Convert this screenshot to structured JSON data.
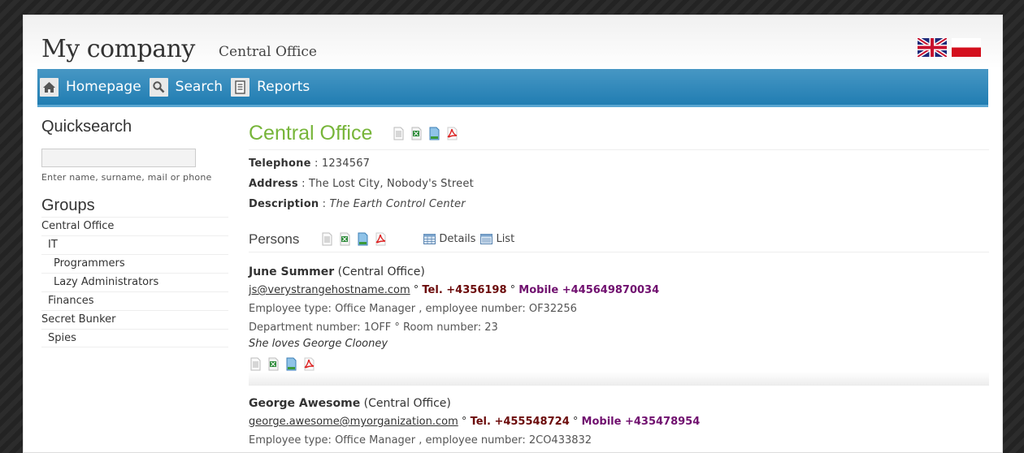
{
  "header": {
    "logo": "My company",
    "subtitle": "Central Office",
    "languages": [
      {
        "name": "English",
        "icon": "flag-uk-icon"
      },
      {
        "name": "Polish",
        "icon": "flag-pl-icon"
      }
    ]
  },
  "nav": {
    "items": [
      {
        "label": "Homepage",
        "icon": "home-icon"
      },
      {
        "label": "Search",
        "icon": "search-icon"
      },
      {
        "label": "Reports",
        "icon": "document-icon"
      }
    ]
  },
  "sidebar": {
    "quicksearch_title": "Quicksearch",
    "quicksearch_value": "",
    "quicksearch_hint": "Enter name, surname, mail or phone",
    "groups_title": "Groups",
    "groups": [
      {
        "label": "Central Office",
        "level": 0
      },
      {
        "label": "IT",
        "level": 1
      },
      {
        "label": "Programmers",
        "level": 2
      },
      {
        "label": "Lazy Administrators",
        "level": 2
      },
      {
        "label": "Finances",
        "level": 1
      },
      {
        "label": "Secret Bunker",
        "level": 0
      },
      {
        "label": "Spies",
        "level": 1
      }
    ]
  },
  "office": {
    "title": "Central Office",
    "export_icons": [
      "text-export-icon",
      "excel-export-icon",
      "document-export-icon",
      "pdf-export-icon"
    ],
    "telephone_label": "Telephone",
    "telephone": "1234567",
    "address_label": "Address",
    "address": "The Lost City, Nobody's Street",
    "description_label": "Description",
    "description": "The Earth Control Center",
    "separator": " : "
  },
  "persons": {
    "title": "Persons",
    "views": [
      {
        "label": "Details",
        "icon": "details-view-icon"
      },
      {
        "label": "List",
        "icon": "list-view-icon"
      }
    ],
    "items": [
      {
        "name": "June Summer",
        "group": "(Central Office)",
        "email": "js@verystrangehostname.com",
        "tel": "Tel. +4356198",
        "mobile": "Mobile +445649870034",
        "employee_line": "Employee type: Office Manager , employee number: OF32256",
        "department_line": "Department number: 1OFF ° Room number: 23",
        "note": "She loves George Clooney"
      },
      {
        "name": "George Awesome",
        "group": "(Central Office)",
        "email": "george.awesome@myorganization.com",
        "tel": "Tel. +455548724",
        "mobile": "Mobile +435478954",
        "employee_line": "Employee type: Office Manager , employee number: 2CO433832"
      }
    ],
    "bullet": "°"
  },
  "colors": {
    "accent_green": "#77b53a",
    "nav_blue": "#217db2",
    "tel_color": "#6b0a0a",
    "mobile_color": "#70106f"
  }
}
